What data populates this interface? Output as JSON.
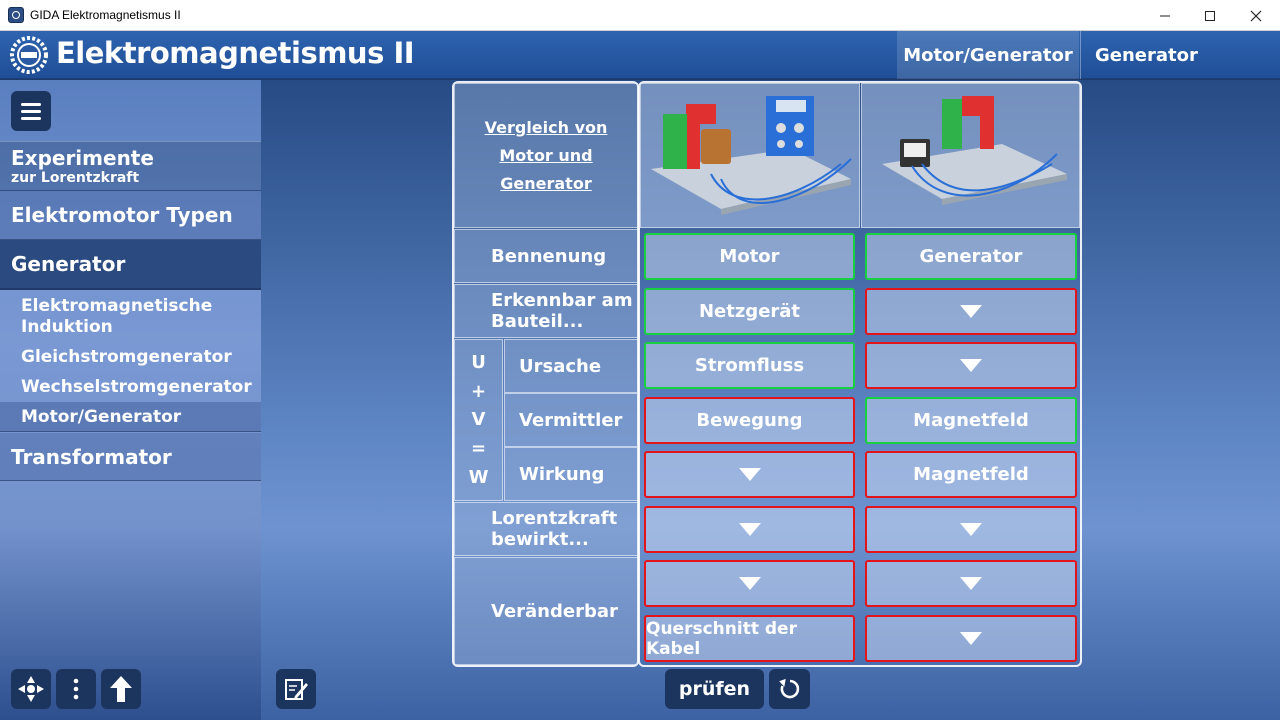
{
  "window": {
    "title": "GIDA Elektromagnetismus II",
    "minimize": "—",
    "maximize": "☐",
    "close": "✕"
  },
  "header": {
    "title": "Elektromagnetismus II",
    "tab_active": "Motor/Generator",
    "tab_current": "Generator"
  },
  "sidebar": {
    "experimente": "Experimente",
    "experimente_sub": "zur Lorentzkraft",
    "typen": "Elektromotor Typen",
    "generator": "Generator",
    "sub": [
      "Elektromagnetische Induktion",
      "Gleichstromgenerator",
      "Wechselstromgenerator",
      "Motor/Generator"
    ],
    "transformator": "Transformator"
  },
  "table": {
    "head_link": [
      "Vergleich von",
      "Motor und",
      "Generator"
    ],
    "uvw": [
      "U",
      "+",
      "V",
      "=",
      "W"
    ],
    "rows": {
      "bennenung": "Bennenung",
      "erkennbar": "Erkennbar am Bauteil...",
      "ursache": "Ursache",
      "vermittler": "Vermittler",
      "wirkung": "Wirkung",
      "lorentz": "Lorentzkraft bewirkt...",
      "veraenderbar": "Veränderbar"
    },
    "values": {
      "motor_bennenung": "Motor",
      "gen_bennenung": "Generator",
      "motor_erkennbar": "Netzgerät",
      "motor_ursache": "Stromfluss",
      "motor_vermittler": "Bewegung",
      "gen_vermittler": "Magnetfeld",
      "gen_wirkung": "Magnetfeld",
      "motor_veraenderbar2": "Querschnitt der Kabel"
    }
  },
  "buttons": {
    "pruefen": "prüfen"
  },
  "colors": {
    "correct": "#17d140",
    "wrong": "#e3141b",
    "button_bg": "#1c355f"
  }
}
